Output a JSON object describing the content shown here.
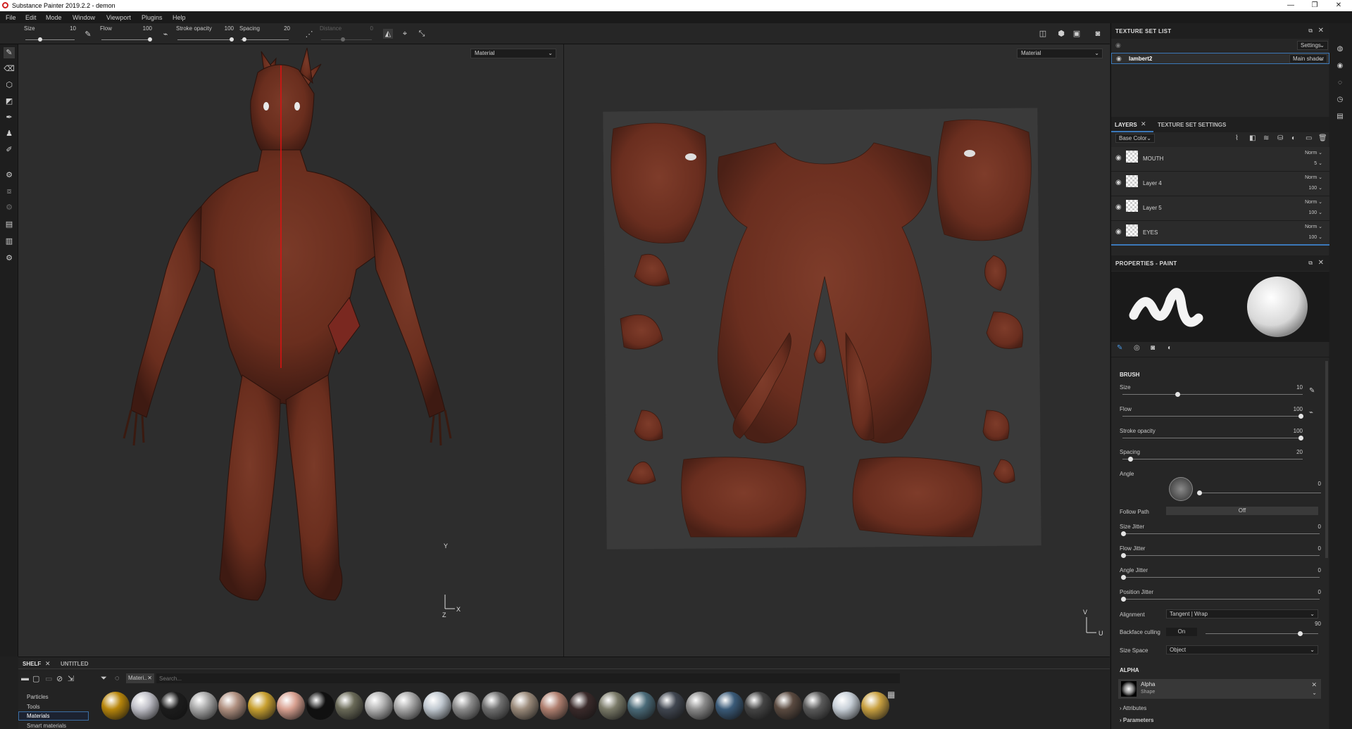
{
  "window": {
    "title": "Substance Painter 2019.2.2 - demon",
    "controls": [
      "—",
      "❐",
      "✕"
    ]
  },
  "menu": [
    "File",
    "Edit",
    "Mode",
    "Window",
    "Viewport",
    "Plugins",
    "Help"
  ],
  "toolbar": {
    "size": {
      "label": "Size",
      "value": "10"
    },
    "flow": {
      "label": "Flow",
      "value": "100"
    },
    "stroke_opacity": {
      "label": "Stroke opacity",
      "value": "100"
    },
    "spacing": {
      "label": "Spacing",
      "value": "20"
    },
    "distance": {
      "label": "Distance",
      "value": "0"
    }
  },
  "viewport_3d": {
    "mode": "Material",
    "axis_y": "Y",
    "axis_x": "X",
    "axis_z": "Z"
  },
  "viewport_2d": {
    "mode": "Material",
    "axis_v": "V",
    "axis_u": "U"
  },
  "texture_set_list": {
    "title": "TEXTURE SET LIST",
    "settings_label": "Settings",
    "item_name": "lambert2",
    "shader": "Main shader"
  },
  "layers_panel": {
    "tab_layers": "LAYERS",
    "tab_settings": "TEXTURE SET SETTINGS",
    "channel": "Base Color",
    "layers": [
      {
        "name": "MOUTH",
        "blend": "Norm",
        "opacity": "5"
      },
      {
        "name": "Layer 4",
        "blend": "Norm",
        "opacity": "100"
      },
      {
        "name": "Layer 5",
        "blend": "Norm",
        "opacity": "100"
      },
      {
        "name": "EYES",
        "blend": "Norm",
        "opacity": "100"
      }
    ]
  },
  "properties": {
    "title": "PROPERTIES - PAINT",
    "brush_section": "BRUSH",
    "size": {
      "label": "Size",
      "value": "10",
      "fraction": 0.3
    },
    "flow": {
      "label": "Flow",
      "value": "100",
      "fraction": 1.0
    },
    "stroke_opacity": {
      "label": "Stroke opacity",
      "value": "100",
      "fraction": 1.0
    },
    "spacing": {
      "label": "Spacing",
      "value": "20",
      "fraction": 0.03
    },
    "angle": {
      "label": "Angle",
      "value": "0"
    },
    "follow_path": {
      "label": "Follow Path",
      "value": "Off"
    },
    "size_jitter": {
      "label": "Size Jitter",
      "value": "0"
    },
    "flow_jitter": {
      "label": "Flow Jitter",
      "value": "0"
    },
    "angle_jitter": {
      "label": "Angle Jitter",
      "value": "0"
    },
    "position_jitter": {
      "label": "Position Jitter",
      "value": "0"
    },
    "alignment": {
      "label": "Alignment",
      "value": "Tangent | Wrap"
    },
    "backface_culling": {
      "label": "Backface culling",
      "toggle": "On",
      "value": "90",
      "fraction": 0.85
    },
    "size_space": {
      "label": "Size Space",
      "value": "Object"
    },
    "alpha_section": "ALPHA",
    "alpha_name": "Alpha",
    "alpha_sub": "Shape",
    "attributes": "Attributes",
    "parameters": "Parameters"
  },
  "shelf": {
    "tab_shelf": "SHELF",
    "tab_untitled": "UNTITLED",
    "filter_chip": "Materi..",
    "search_placeholder": "Search...",
    "categories": [
      "Particles",
      "Tools",
      "Materials",
      "Smart materials"
    ],
    "selected_category": "Materials",
    "material_colors": [
      "#b8860b",
      "#c0c0c8",
      "#1c1c1c",
      "#a8a8a8",
      "#b09080",
      "#c8a030",
      "#d8a090",
      "#101010",
      "#6a6a58",
      "#b4b4b4",
      "#a8a8a8",
      "#c0c8d0",
      "#8c8c8c",
      "#707070",
      "#9a8a7a",
      "#b08070",
      "#3a2a2a",
      "#7a7a68",
      "#4a6a78",
      "#404650",
      "#8a8a8a",
      "#3a5a78",
      "#444444",
      "#5a4a40",
      "#5a5a5a",
      "#c8d0d8",
      "#c8a040"
    ]
  }
}
